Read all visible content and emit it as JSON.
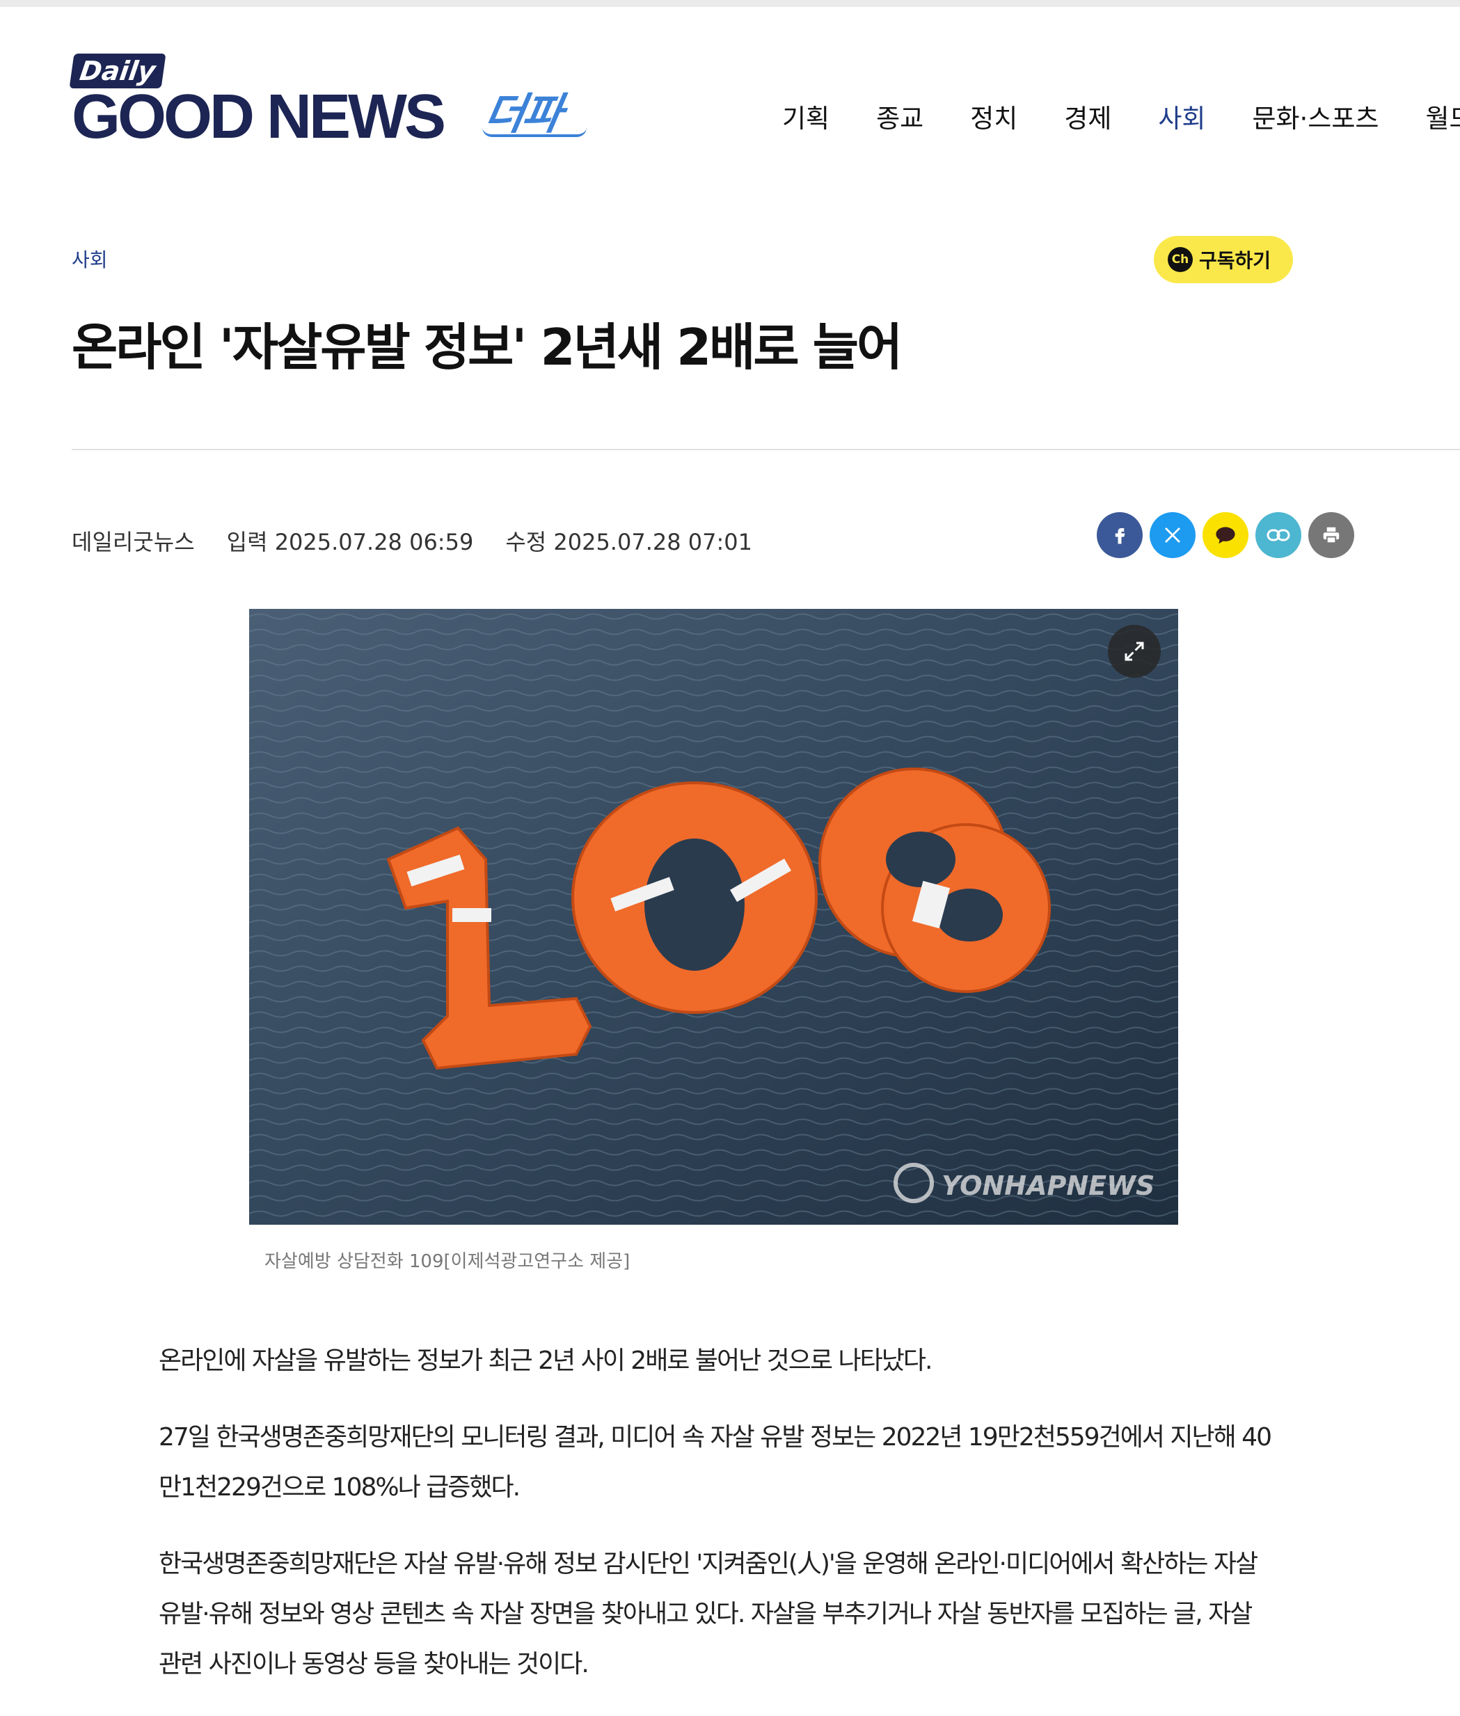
{
  "site": {
    "logo_daily": "Daily",
    "logo_brand": "GOOD NEWS",
    "logo_sub": "더파"
  },
  "nav": {
    "items": [
      "기획",
      "종교",
      "정치",
      "경제",
      "사회",
      "문화·스포츠",
      "월드"
    ],
    "active": "사회"
  },
  "article": {
    "section": "사회",
    "subscribe_icon": "Ch",
    "subscribe_label": "구독하기",
    "title": "온라인 '자살유발 정보' 2년새 2배로 늘어",
    "source": "데일리굿뉴스",
    "input_time": "입력 2025.07.28 06:59",
    "modified_time": "수정 2025.07.28 07:01",
    "share_icons": [
      "facebook-icon",
      "x-icon",
      "kakaotalk-icon",
      "link-icon",
      "print-icon"
    ],
    "photo": {
      "overlay_text": "109",
      "watermark": "YONHAPNEWS",
      "caption": "자살예방 상담전화 109[이제석광고연구소 제공]"
    },
    "paragraphs": [
      "온라인에 자살을 유발하는 정보가 최근 2년 사이 2배로 불어난 것으로 나타났다.",
      "27일 한국생명존중희망재단의 모니터링 결과, 미디어 속 자살 유발 정보는 2022년 19만2천559건에서 지난해 40만1천229건으로 108%나 급증했다.",
      "한국생명존중희망재단은 자살 유발·유해 정보 감시단인 '지켜줌인(人)'을 운영해 온라인·미디어에서 확산하는 자살 유발·유해 정보와 영상 콘텐츠 속 자살 장면을 찾아내고 있다. 자살을 부추기거나 자살 동반자를 모집하는 글, 자살 관련 사진이나 동영상 등을 찾아내는 것이다."
    ]
  },
  "colors": {
    "brand_navy": "#1c2553",
    "accent_blue": "#1f3d8a",
    "subscribe_yellow": "#fae84a",
    "buoy_orange": "#f06a2a"
  }
}
